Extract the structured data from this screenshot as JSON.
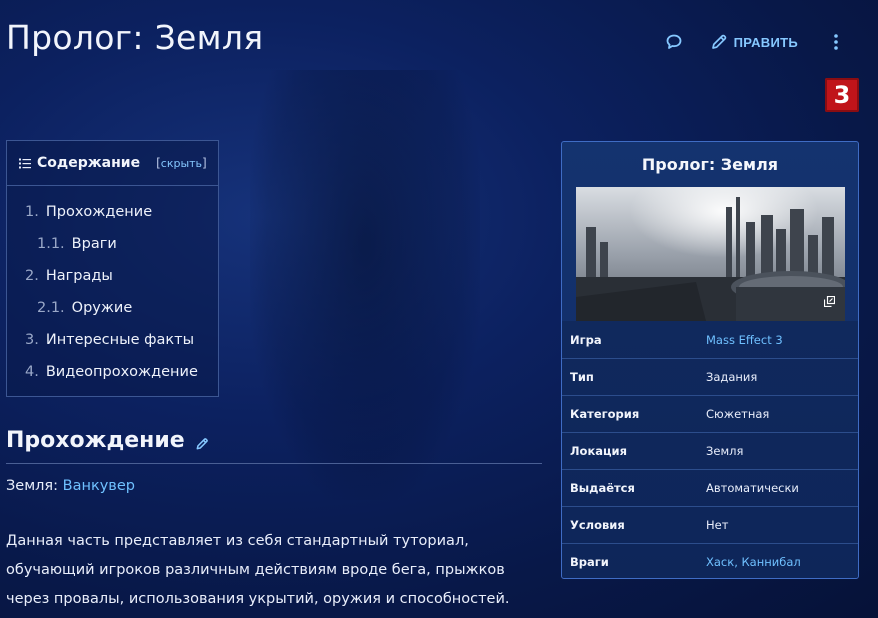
{
  "page": {
    "title": "Пролог: Земля"
  },
  "actions": {
    "edit_label": "ПРАВИТЬ"
  },
  "game_logo": {
    "label": "3",
    "color": "#c0141a"
  },
  "toc": {
    "title": "Содержание",
    "toggle_open": "[",
    "toggle_label": "скрыть",
    "toggle_close": "]",
    "items": [
      {
        "num": "1.",
        "text": "Прохождение",
        "level": 1
      },
      {
        "num": "1.1.",
        "text": "Враги",
        "level": 2
      },
      {
        "num": "2.",
        "text": "Награды",
        "level": 1
      },
      {
        "num": "2.1.",
        "text": "Оружие",
        "level": 2
      },
      {
        "num": "3.",
        "text": "Интересные факты",
        "level": 1
      },
      {
        "num": "4.",
        "text": "Видеопрохождение",
        "level": 1
      }
    ]
  },
  "section": {
    "heading": "Прохождение",
    "location_label": "Земля:",
    "location_link": "Ванкувер",
    "paragraph_line1": "Данная часть представляет из себя стандартный туториал,",
    "paragraph_line2": "обучающий игроков различным действиям вроде бега, прыжков",
    "paragraph_line3": "через провалы, использования укрытий, оружия и способностей."
  },
  "infobox": {
    "title": "Пролог: Земля",
    "rows": [
      {
        "label": "Игра",
        "value": "Mass Effect 3",
        "link": true
      },
      {
        "label": "Тип",
        "value": "Задания",
        "link": false
      },
      {
        "label": "Категория",
        "value": "Сюжетная",
        "link": false
      },
      {
        "label": "Локация",
        "value": "Земля",
        "link": false
      },
      {
        "label": "Выдаётся",
        "value": "Автоматически",
        "link": false
      },
      {
        "label": "Условия",
        "value": "Нет",
        "link": false
      },
      {
        "label": "Враги",
        "value": "Хаск, Каннибал",
        "link": true
      }
    ]
  },
  "colors": {
    "accent_link": "#6fc0ff",
    "edit_blue": "#86c8ff",
    "background": "#0c2160"
  }
}
